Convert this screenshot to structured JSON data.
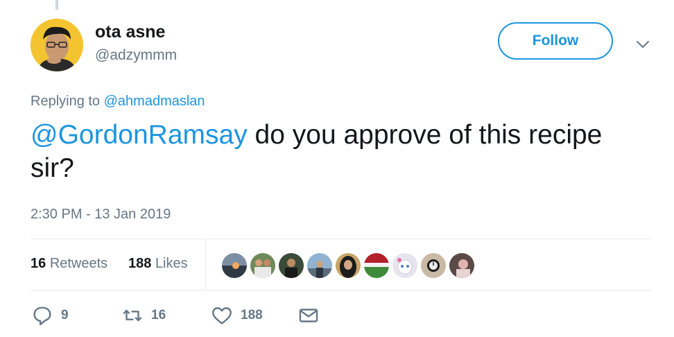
{
  "author": {
    "name": "ota asne",
    "handle": "@adzymmm"
  },
  "follow_label": "Follow",
  "reply_context": {
    "prefix": "Replying to",
    "mention": "@ahmadmaslan"
  },
  "tweet": {
    "mention": "@GordonRamsay",
    "text": " do you approve of this recipe sir?"
  },
  "timestamp": "2:30 PM - 13 Jan 2019",
  "stats": {
    "retweets_count": "16",
    "retweets_label": "Retweets",
    "likes_count": "188",
    "likes_label": "Likes"
  },
  "likers": [
    {
      "icon": "liker-avatar-sunset"
    },
    {
      "icon": "liker-avatar-group"
    },
    {
      "icon": "liker-avatar-person"
    },
    {
      "icon": "liker-avatar-outdoor"
    },
    {
      "icon": "liker-avatar-hijab"
    },
    {
      "icon": "liker-avatar-stadium"
    },
    {
      "icon": "liker-avatar-cat"
    },
    {
      "icon": "liker-avatar-watch"
    },
    {
      "icon": "liker-avatar-selfie"
    }
  ],
  "actions": {
    "replies": "9",
    "retweets": "16",
    "likes": "188"
  },
  "colors": {
    "link": "#1b95e0",
    "secondary_text": "#657786",
    "divider": "#e6ecf0"
  }
}
